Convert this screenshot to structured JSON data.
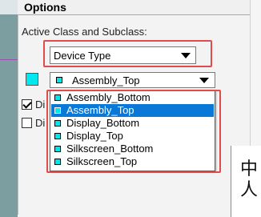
{
  "panel": {
    "title": "Options",
    "active_class_label": "Active Class and Subclass:"
  },
  "class_combo": {
    "value": "Device Type"
  },
  "subclass_combo": {
    "value": "Assembly_Top",
    "swatch_color": "#00e7f0"
  },
  "checkboxes": [
    {
      "label": "Di",
      "checked": true
    },
    {
      "label": "Di",
      "checked": false
    }
  ],
  "dropdown": {
    "options": [
      {
        "label": "Assembly_Bottom",
        "selected": false
      },
      {
        "label": "Assembly_Top",
        "selected": true
      },
      {
        "label": "Display_Bottom",
        "selected": false
      },
      {
        "label": "Display_Top",
        "selected": false
      },
      {
        "label": "Silkscreen_Bottom",
        "selected": false
      },
      {
        "label": "Silkscreen_Top",
        "selected": false
      }
    ]
  },
  "canvas_text": {
    "line1": "中",
    "line2": "人"
  },
  "colors": {
    "highlight": "#0a78d7",
    "annotation_red": "#e04b4b",
    "swatch_cyan": "#00e7f0"
  },
  "icons": {
    "combo_arrow": "chevron-down-icon"
  }
}
